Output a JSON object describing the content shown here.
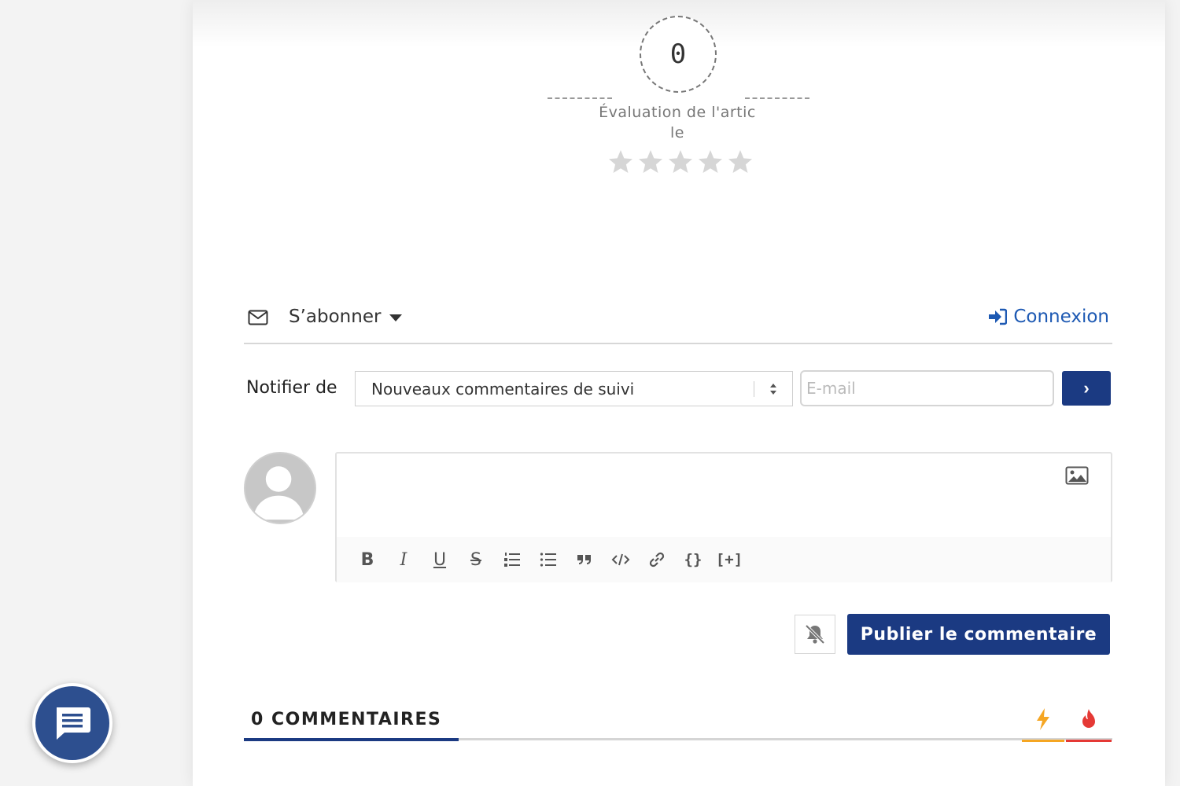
{
  "rating": {
    "score": "0",
    "label": "Évaluation de l'article",
    "stars_total": 5,
    "stars_filled": 0
  },
  "subscribe": {
    "label": "S’abonner",
    "login_label": "Connexion"
  },
  "notify": {
    "label": "Notifier de",
    "selected_option": "Nouveaux commentaires de suivi",
    "email_placeholder": "E-mail",
    "submit_label": "›"
  },
  "editor": {
    "toolbar": {
      "bold": "B",
      "italic": "I",
      "underline": "U",
      "strike": "S",
      "code_block": "{}",
      "spoiler": "[+]"
    }
  },
  "publish": {
    "label": "Publier le commentaire"
  },
  "comments": {
    "title": "0 COMMENTAIRES"
  },
  "colors": {
    "primary": "#1b3a82",
    "link": "#1d59b3",
    "newest": "#f5a623",
    "hottest": "#e53935",
    "chat": "#2d4f8f"
  }
}
